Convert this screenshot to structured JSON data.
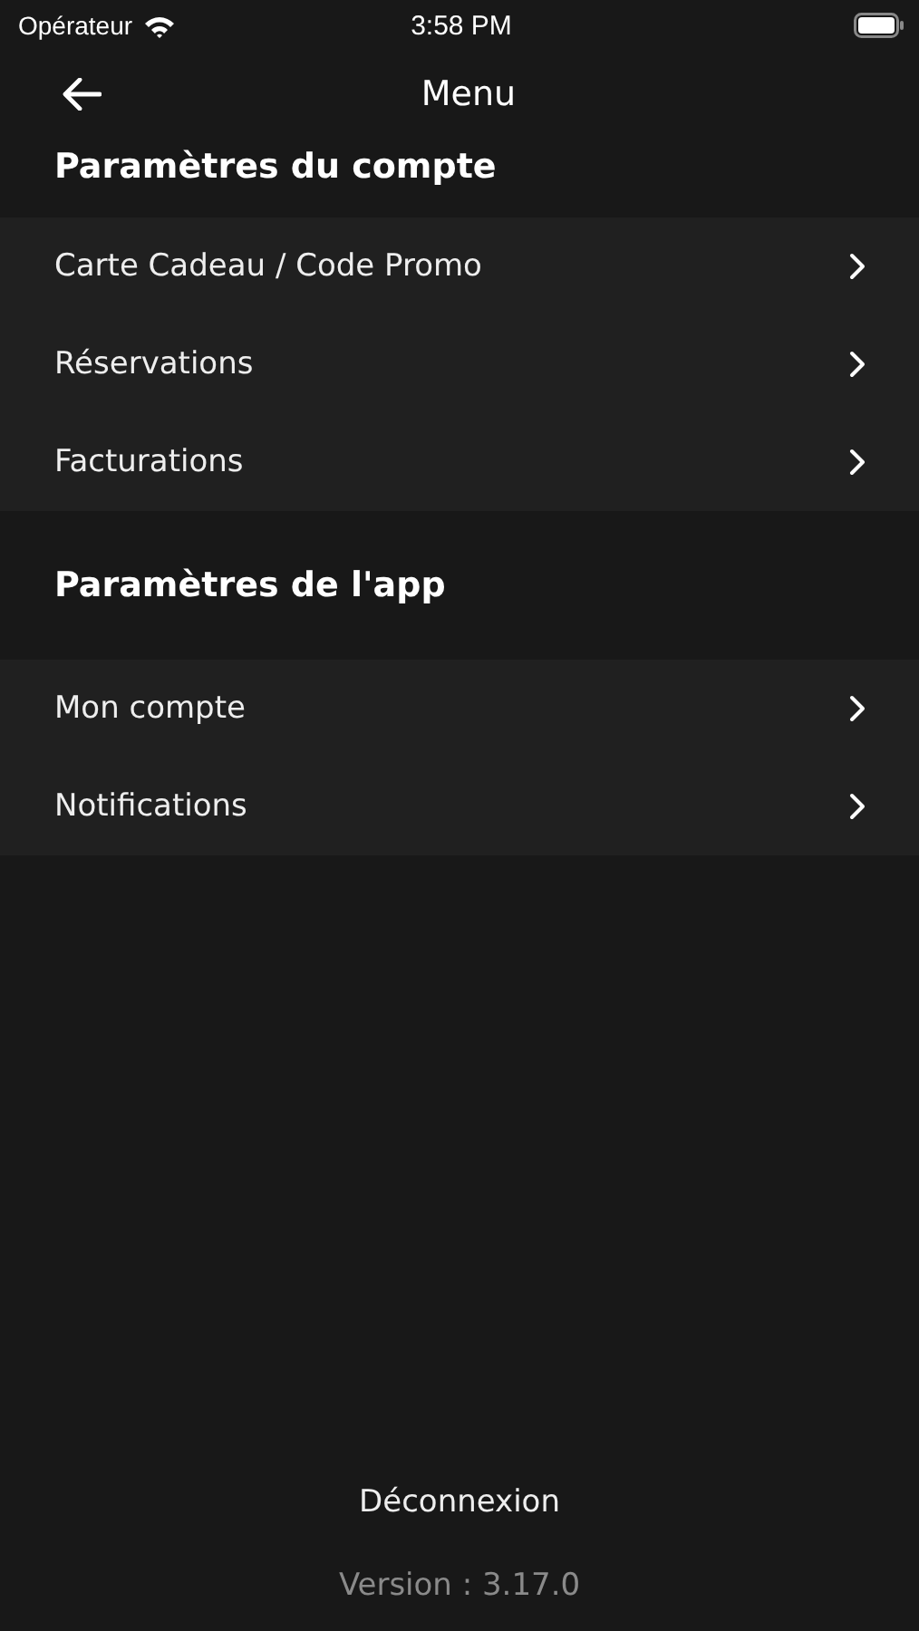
{
  "status_bar": {
    "carrier": "Opérateur",
    "time": "3:58 PM"
  },
  "nav": {
    "title": "Menu"
  },
  "sections": [
    {
      "title": "Paramètres du compte",
      "items": [
        {
          "label": "Carte Cadeau / Code Promo"
        },
        {
          "label": "Réservations"
        },
        {
          "label": "Facturations"
        }
      ]
    },
    {
      "title": "Paramètres de l'app",
      "items": [
        {
          "label": "Mon compte"
        },
        {
          "label": "Notifications"
        }
      ]
    }
  ],
  "logout": "Déconnexion",
  "version": "Version : 3.17.0"
}
